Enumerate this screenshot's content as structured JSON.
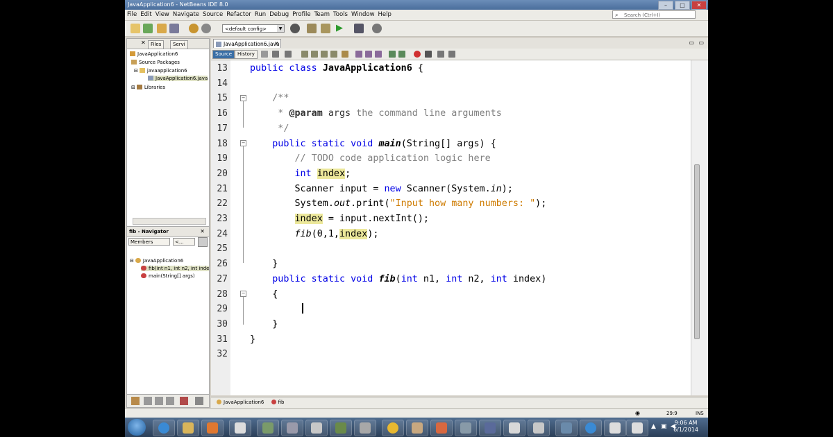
{
  "window": {
    "title": "JavaApplication6 - NetBeans IDE 8.0"
  },
  "menu": [
    "File",
    "Edit",
    "View",
    "Navigate",
    "Source",
    "Refactor",
    "Run",
    "Debug",
    "Profile",
    "Team",
    "Tools",
    "Window",
    "Help"
  ],
  "search": {
    "placeholder": "Search (Ctrl+I)"
  },
  "toolbar": {
    "config": "<default config>"
  },
  "projects_panel": {
    "tabs": [
      "Files",
      "Servi"
    ],
    "tree": [
      {
        "label": "JavaApplication6"
      },
      {
        "label": "Source Packages"
      },
      {
        "label": "javaapplication6"
      },
      {
        "label": "JavaApplication6.java"
      },
      {
        "label": "Libraries"
      }
    ]
  },
  "navigator": {
    "title": "fib - Navigator",
    "filter": "Members",
    "filter2": "<...",
    "tree": [
      {
        "label": "JavaApplication6"
      },
      {
        "label": "fib(int n1, int n2, int inde"
      },
      {
        "label": "main(String[] args)"
      }
    ]
  },
  "editor": {
    "file_tab": "JavaApplication6.java",
    "source_tab": "Source",
    "history_tab": "History",
    "line_numbers": [
      "13",
      "14",
      "15",
      "16",
      "17",
      "18",
      "19",
      "20",
      "21",
      "22",
      "23",
      "24",
      "25",
      "26",
      "27",
      "28",
      "29",
      "30",
      "31",
      "32"
    ]
  },
  "breadcrumb": {
    "class": "JavaApplication6",
    "method": "fib"
  },
  "status": {
    "position": "29:9",
    "mode": "INS"
  },
  "clock": {
    "time": "9:06 AM",
    "date": "6/1/2014"
  },
  "colors": {
    "keyword": "#0000e6",
    "comment": "#808080",
    "string": "#ce7b00",
    "mark_occurrence": "#ece89b"
  }
}
